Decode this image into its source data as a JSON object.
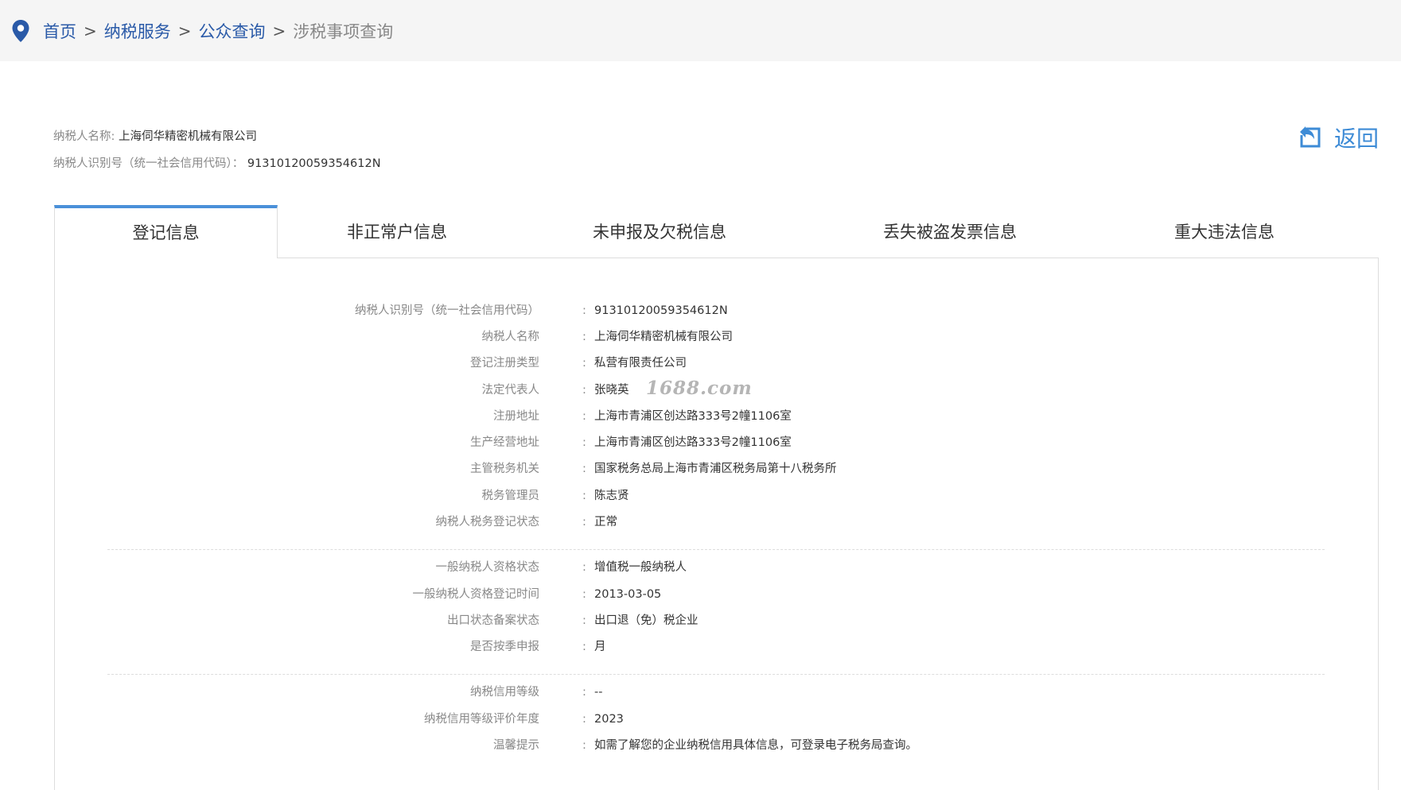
{
  "breadcrumb": {
    "home": "首页",
    "sep1": ">",
    "service": "纳税服务",
    "sep2": ">",
    "public_query": "公众查询",
    "sep3": ">",
    "current": "涉税事项查询"
  },
  "taxpayer": {
    "name_label": "纳税人名称:",
    "name": "上海伺华精密机械有限公司",
    "id_label": "纳税人识别号（统一社会信用代码）：",
    "id": "91310120059354612N"
  },
  "back_label": "返回",
  "tabs": [
    {
      "label": "登记信息",
      "active": true
    },
    {
      "label": "非正常户信息",
      "active": false
    },
    {
      "label": "未申报及欠税信息",
      "active": false
    },
    {
      "label": "丢失被盗发票信息",
      "active": false
    },
    {
      "label": "重大违法信息",
      "active": false
    }
  ],
  "registration": {
    "group1": [
      {
        "label": "纳税人识别号（统一社会信用代码）",
        "value": "91310120059354612N"
      },
      {
        "label": "纳税人名称",
        "value": "上海伺华精密机械有限公司"
      },
      {
        "label": "登记注册类型",
        "value": "私营有限责任公司"
      },
      {
        "label": "法定代表人",
        "value": "张晓英"
      },
      {
        "label": "注册地址",
        "value": "上海市青浦区创达路333号2幢1106室"
      },
      {
        "label": "生产经营地址",
        "value": "上海市青浦区创达路333号2幢1106室"
      },
      {
        "label": "主管税务机关",
        "value": "国家税务总局上海市青浦区税务局第十八税务所"
      },
      {
        "label": "税务管理员",
        "value": "陈志贤"
      },
      {
        "label": "纳税人税务登记状态",
        "value": "正常"
      }
    ],
    "group2": [
      {
        "label": "一般纳税人资格状态",
        "value": "增值税一般纳税人"
      },
      {
        "label": "一般纳税人资格登记时间",
        "value": "2013-03-05"
      },
      {
        "label": "出口状态备案状态",
        "value": "出口退（免）税企业"
      },
      {
        "label": "是否按季申报",
        "value": "月"
      }
    ],
    "group3": [
      {
        "label": "纳税信用等级",
        "value": "--"
      },
      {
        "label": "纳税信用等级评价年度",
        "value": "2023"
      },
      {
        "label": "温馨提示",
        "value": "如需了解您的企业纳税信用具体信息，可登录电子税务局查询。"
      }
    ],
    "colon": ":"
  },
  "watermark_text": "1688.com",
  "colors": {
    "link": "#2a5aa8",
    "accent": "#4a90d9",
    "back": "#3d8bd6"
  },
  "icons": {
    "location": "location-pin-icon",
    "back": "back-arrow-icon"
  }
}
